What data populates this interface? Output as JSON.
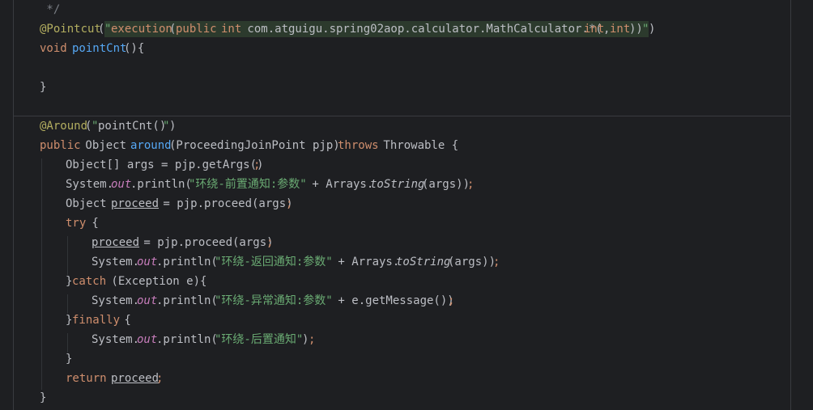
{
  "colors": {
    "background": "#1e1f22",
    "default": "#bcbec4",
    "keyword": "#cf8e6d",
    "annotation": "#b3ae60",
    "string": "#6aab73",
    "method_decl": "#56a8f5",
    "static_field": "#c77dbb",
    "comment": "#7a7e85",
    "pointcut_highlight": "#2c3a2d"
  },
  "lines": [
    {
      "tokens": [
        {
          "t": " */",
          "k": "comment"
        }
      ]
    },
    {
      "tokens": [
        {
          "t": "@Pointcut",
          "k": "annotation"
        },
        {
          "t": "(",
          "k": "default"
        },
        {
          "t": "\"",
          "k": "string"
        },
        {
          "t": "execution",
          "k": "keyword"
        },
        {
          "t": "(",
          "k": "default"
        },
        {
          "t": "public",
          "k": "keyword"
        },
        {
          "t": " ",
          "k": "default"
        },
        {
          "t": "int",
          "k": "keyword"
        },
        {
          "t": " com.atguigu.spring02aop.calculator.MathCalculator.*(",
          "k": "default"
        },
        {
          "t": "int",
          "k": "keyword"
        },
        {
          "t": ",",
          "k": "default"
        },
        {
          "t": "int",
          "k": "keyword"
        },
        {
          "t": "))",
          "k": "default"
        },
        {
          "t": "\"",
          "k": "string"
        },
        {
          "t": ")",
          "k": "default"
        }
      ]
    },
    {
      "tokens": [
        {
          "t": "void",
          "k": "keyword"
        },
        {
          "t": " ",
          "k": "default"
        },
        {
          "t": "pointCnt",
          "k": "method_decl"
        },
        {
          "t": "(){",
          "k": "default"
        }
      ]
    },
    {
      "tokens": []
    },
    {
      "tokens": [
        {
          "t": "}",
          "k": "default"
        }
      ]
    },
    {
      "tokens": []
    },
    {
      "tokens": [
        {
          "t": "@Around",
          "k": "annotation"
        },
        {
          "t": "(",
          "k": "default"
        },
        {
          "t": "\"",
          "k": "string"
        },
        {
          "t": "pointCnt()",
          "k": "default"
        },
        {
          "t": "\"",
          "k": "string"
        },
        {
          "t": ")",
          "k": "default"
        }
      ]
    },
    {
      "tokens": [
        {
          "t": "public",
          "k": "keyword"
        },
        {
          "t": " Object ",
          "k": "default"
        },
        {
          "t": "around",
          "k": "method_decl"
        },
        {
          "t": "(ProceedingJoinPoint pjp) ",
          "k": "default"
        },
        {
          "t": "throws",
          "k": "keyword"
        },
        {
          "t": " Throwable {",
          "k": "default"
        }
      ]
    },
    {
      "tokens": [
        {
          "t": "Object[] args = pjp.getArgs()",
          "k": "default"
        },
        {
          "t": ";",
          "k": "keyword"
        }
      ]
    },
    {
      "tokens": [
        {
          "t": "System.",
          "k": "default"
        },
        {
          "t": "out",
          "k": "static_field",
          "i": true
        },
        {
          "t": ".println(",
          "k": "default"
        },
        {
          "t": "\"环绕-前置通知:参数\"",
          "k": "string"
        },
        {
          "t": " + Arrays.",
          "k": "default"
        },
        {
          "t": "toString",
          "k": "default",
          "i": true
        },
        {
          "t": "(args))",
          "k": "default"
        },
        {
          "t": ";",
          "k": "keyword"
        }
      ]
    },
    {
      "tokens": [
        {
          "t": "Object ",
          "k": "default"
        },
        {
          "t": "proceed",
          "k": "default",
          "u": true
        },
        {
          "t": " = pjp.proceed(args)",
          "k": "default"
        },
        {
          "t": ";",
          "k": "keyword"
        }
      ]
    },
    {
      "tokens": [
        {
          "t": "try",
          "k": "keyword"
        },
        {
          "t": " {",
          "k": "default"
        }
      ]
    },
    {
      "tokens": [
        {
          "t": "proceed",
          "k": "default",
          "u": true
        },
        {
          "t": " = pjp.proceed(args)",
          "k": "default"
        },
        {
          "t": ";",
          "k": "keyword"
        }
      ]
    },
    {
      "tokens": [
        {
          "t": "System.",
          "k": "default"
        },
        {
          "t": "out",
          "k": "static_field",
          "i": true
        },
        {
          "t": ".println(",
          "k": "default"
        },
        {
          "t": "\"环绕-返回通知:参数\"",
          "k": "string"
        },
        {
          "t": " + Arrays.",
          "k": "default"
        },
        {
          "t": "toString",
          "k": "default",
          "i": true
        },
        {
          "t": "(args))",
          "k": "default"
        },
        {
          "t": ";",
          "k": "keyword"
        }
      ]
    },
    {
      "tokens": [
        {
          "t": "}",
          "k": "default"
        },
        {
          "t": "catch",
          "k": "keyword"
        },
        {
          "t": " (Exception e){",
          "k": "default"
        }
      ]
    },
    {
      "tokens": [
        {
          "t": "System.",
          "k": "default"
        },
        {
          "t": "out",
          "k": "static_field",
          "i": true
        },
        {
          "t": ".println(",
          "k": "default"
        },
        {
          "t": "\"环绕-异常通知:参数\"",
          "k": "string"
        },
        {
          "t": " + e.getMessage())",
          "k": "default"
        },
        {
          "t": ";",
          "k": "keyword"
        }
      ]
    },
    {
      "tokens": [
        {
          "t": "}",
          "k": "default"
        },
        {
          "t": "finally",
          "k": "keyword"
        },
        {
          "t": " {",
          "k": "default"
        }
      ]
    },
    {
      "tokens": [
        {
          "t": "System.",
          "k": "default"
        },
        {
          "t": "out",
          "k": "static_field",
          "i": true
        },
        {
          "t": ".println(",
          "k": "default"
        },
        {
          "t": "\"环绕-后置通知\"",
          "k": "string"
        },
        {
          "t": ")",
          "k": "default"
        },
        {
          "t": ";",
          "k": "keyword"
        }
      ]
    },
    {
      "tokens": [
        {
          "t": "}",
          "k": "default"
        }
      ]
    },
    {
      "tokens": [
        {
          "t": "return",
          "k": "keyword"
        },
        {
          "t": " ",
          "k": "default"
        },
        {
          "t": "proceed",
          "k": "default",
          "u": true
        },
        {
          "t": ";",
          "k": "keyword"
        }
      ]
    },
    {
      "tokens": [
        {
          "t": "}",
          "k": "default"
        }
      ]
    }
  ]
}
